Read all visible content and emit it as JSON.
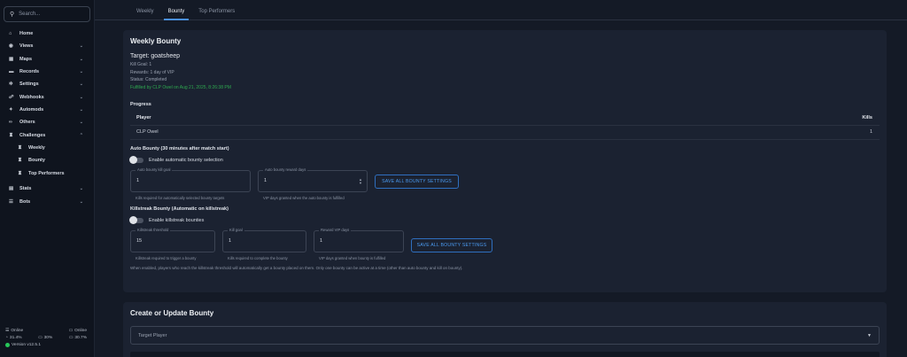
{
  "sidebar": {
    "search_placeholder": "Search...",
    "items": [
      {
        "label": "Home",
        "icon": "home-icon",
        "glyph": "⌂",
        "chevron": ""
      },
      {
        "label": "Views",
        "icon": "eye-icon",
        "glyph": "◉",
        "chevron": "⌄"
      },
      {
        "label": "Maps",
        "icon": "map-icon",
        "glyph": "▦",
        "chevron": "⌄"
      },
      {
        "label": "Records",
        "icon": "folder-icon",
        "glyph": "▬",
        "chevron": "⌄"
      },
      {
        "label": "Settings",
        "icon": "gear-icon",
        "glyph": "✲",
        "chevron": "⌄"
      },
      {
        "label": "Webhooks",
        "icon": "webhook-icon",
        "glyph": "☍",
        "chevron": "⌄"
      },
      {
        "label": "Automods",
        "icon": "robot-icon",
        "glyph": "✦",
        "chevron": "⌄"
      },
      {
        "label": "Others",
        "icon": "link-icon",
        "glyph": "∞",
        "chevron": "⌄"
      },
      {
        "label": "Challenges",
        "icon": "trophy-icon",
        "glyph": "♜",
        "chevron": "⌃"
      }
    ],
    "sub_items": [
      {
        "label": "Weekly",
        "icon": "trophy-icon",
        "glyph": "♜"
      },
      {
        "label": "Bounty",
        "icon": "trophy-icon",
        "glyph": "♜"
      },
      {
        "label": "Top Performers",
        "icon": "trophy-icon",
        "glyph": "♜"
      }
    ],
    "items_bottom": [
      {
        "label": "Stats",
        "icon": "chart-icon",
        "glyph": "▤",
        "chevron": "⌄"
      },
      {
        "label": "Bots",
        "icon": "bot-icon",
        "glyph": "☰",
        "chevron": "⌄"
      }
    ],
    "footer": {
      "online_left": "Online",
      "online_right": "Online",
      "cpu": "31.4%",
      "ram": "30%",
      "disk": "30.7%",
      "version": "Version v12.5.1"
    }
  },
  "tabs": [
    "Weekly",
    "Bounty",
    "Top Performers"
  ],
  "bounty": {
    "title": "Weekly Bounty",
    "target": "Target: goatsheep",
    "kill_goal": "Kill Goal: 1",
    "rewards": "Rewards: 1 day of VIP",
    "status": "Status: Completed",
    "fulfilled": "Fulfilled by CLP Owel on Aug 21, 2025, 8:26:38 PM",
    "progress_title": "Progress",
    "table_headers": {
      "player": "Player",
      "kills": "Kills"
    },
    "table_rows": [
      {
        "player": "CLP Owel",
        "kills": "1"
      }
    ]
  },
  "auto": {
    "title": "Auto Bounty (30 minutes after match start)",
    "toggle_label": "Enable automatic bounty selection",
    "kill_goal_label": "Auto bounty kill goal",
    "kill_goal_value": "1",
    "kill_goal_help": "Kills required for automatically selected bounty targets",
    "reward_label": "Auto bounty reward days",
    "reward_value": "1",
    "reward_help": "VIP days granted when the auto bounty is fulfilled",
    "save_label": "SAVE ALL BOUNTY SETTINGS"
  },
  "killstreak": {
    "title": "Killstreak Bounty (Automatic on killstreak)",
    "toggle_label": "Enable killstreak bounties",
    "threshold_label": "Killstreak threshold",
    "threshold_value": "15",
    "threshold_help": "Killstreak required to trigger a bounty",
    "kill_goal_label": "Kill goal",
    "kill_goal_value": "1",
    "kill_goal_help": "Kills required to complete the bounty",
    "reward_label": "Reward VIP days",
    "reward_value": "1",
    "reward_help": "VIP days granted when bounty is fulfilled",
    "save_label": "SAVE ALL BOUNTY SETTINGS",
    "note": "When enabled, players who reach the killstreak threshold will automatically get a bounty placed on them. Only one bounty can be active at a time (other than auto bounty and kill on bounty)."
  },
  "create": {
    "title": "Create or Update Bounty",
    "target_placeholder": "Target Player"
  },
  "colors": {
    "accent": "#4a90e2",
    "success": "#2ea84f",
    "online": "#27c85a"
  }
}
